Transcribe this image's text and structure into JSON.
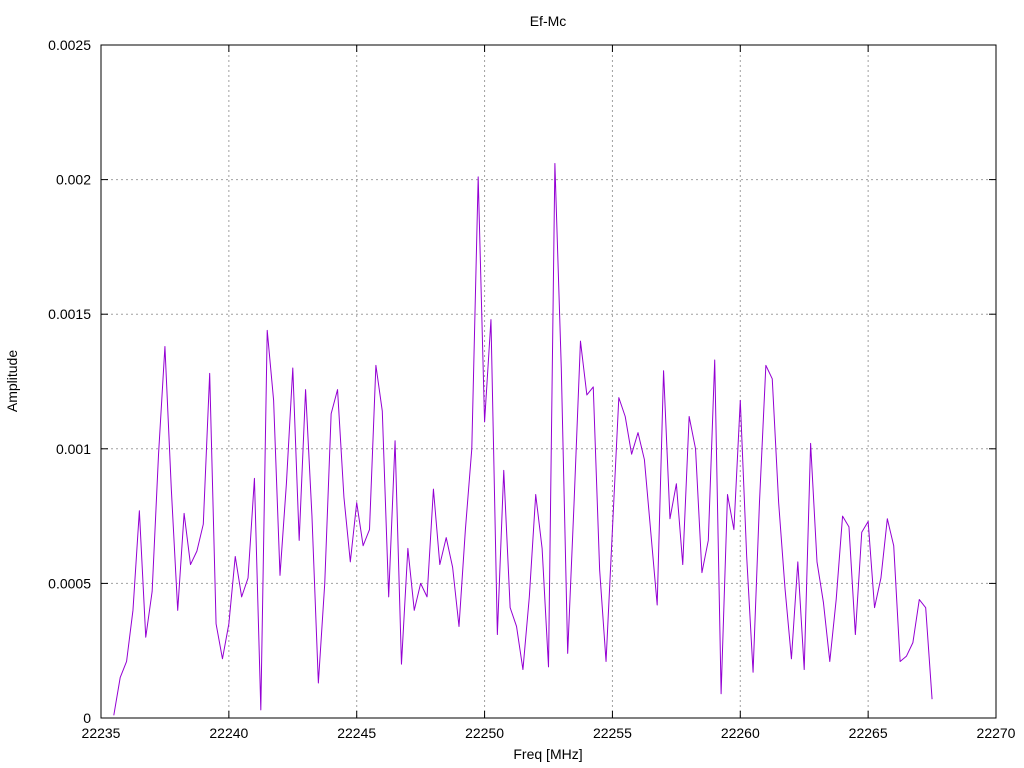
{
  "chart_data": {
    "type": "line",
    "title": "Ef-Mc",
    "xlabel": "Freq [MHz]",
    "ylabel": "Amplitude",
    "xlim": [
      22235,
      22270
    ],
    "ylim": [
      0,
      0.0025
    ],
    "x_ticks": [
      "22235",
      "22240",
      "22245",
      "22250",
      "22255",
      "22260",
      "22265",
      "22270"
    ],
    "x_tick_values": [
      22235,
      22240,
      22245,
      22250,
      22255,
      22260,
      22265,
      22270
    ],
    "y_ticks": [
      "0",
      "0.0005",
      "0.001",
      "0.0015",
      "0.002",
      "0.0025"
    ],
    "y_tick_values": [
      0,
      0.0005,
      0.001,
      0.0015,
      0.002,
      0.0025
    ],
    "grid": true,
    "legend": "none",
    "series": [
      {
        "color": "#9400d3",
        "x": [
          22235.5,
          22235.75,
          22236.0,
          22236.25,
          22236.5,
          22236.75,
          22237.0,
          22237.25,
          22237.5,
          22237.75,
          22238.0,
          22238.25,
          22238.5,
          22238.75,
          22239.0,
          22239.25,
          22239.5,
          22239.75,
          22240.0,
          22240.25,
          22240.5,
          22240.75,
          22241.0,
          22241.25,
          22241.5,
          22241.75,
          22242.0,
          22242.25,
          22242.5,
          22242.75,
          22243.0,
          22243.25,
          22243.5,
          22243.75,
          22244.0,
          22244.25,
          22244.5,
          22244.75,
          22245.0,
          22245.25,
          22245.5,
          22245.75,
          22246.0,
          22246.25,
          22246.5,
          22246.75,
          22247.0,
          22247.25,
          22247.5,
          22247.75,
          22248.0,
          22248.25,
          22248.5,
          22248.75,
          22249.0,
          22249.25,
          22249.5,
          22249.75,
          22250.0,
          22250.25,
          22250.5,
          22250.75,
          22251.0,
          22251.25,
          22251.5,
          22251.75,
          22252.0,
          22252.25,
          22252.5,
          22252.75,
          22253.0,
          22253.25,
          22253.5,
          22253.75,
          22254.0,
          22254.25,
          22254.5,
          22254.75,
          22255.0,
          22255.25,
          22255.5,
          22255.75,
          22256.0,
          22256.25,
          22256.5,
          22256.75,
          22257.0,
          22257.25,
          22257.5,
          22257.75,
          22258.0,
          22258.25,
          22258.5,
          22258.75,
          22259.0,
          22259.25,
          22259.5,
          22259.75,
          22260.0,
          22260.25,
          22260.5,
          22260.75,
          22261.0,
          22261.25,
          22261.5,
          22261.75,
          22262.0,
          22262.25,
          22262.5,
          22262.75,
          22263.0,
          22263.25,
          22263.5,
          22263.75,
          22264.0,
          22264.25,
          22264.5,
          22264.75,
          22265.0,
          22265.25,
          22265.5,
          22265.75,
          22266.0,
          22266.25,
          22266.5,
          22266.75,
          22267.0,
          22267.25,
          22267.5
        ],
        "y": [
          1e-05,
          0.00015,
          0.00021,
          0.0004,
          0.00077,
          0.0003,
          0.00047,
          0.00098,
          0.00138,
          0.00085,
          0.0004,
          0.00076,
          0.00057,
          0.00062,
          0.00072,
          0.00128,
          0.00035,
          0.00022,
          0.00035,
          0.0006,
          0.00045,
          0.00052,
          0.00089,
          3e-05,
          0.00144,
          0.00118,
          0.00053,
          0.00087,
          0.0013,
          0.00066,
          0.00122,
          0.00075,
          0.00013,
          0.0005,
          0.00113,
          0.00122,
          0.00082,
          0.00058,
          0.0008,
          0.00064,
          0.0007,
          0.00131,
          0.00114,
          0.00045,
          0.00103,
          0.0002,
          0.00063,
          0.0004,
          0.0005,
          0.00045,
          0.00085,
          0.00057,
          0.00067,
          0.00056,
          0.00034,
          0.0007,
          0.001,
          0.00201,
          0.0011,
          0.00148,
          0.00031,
          0.00092,
          0.00041,
          0.00034,
          0.00018,
          0.00045,
          0.00083,
          0.00063,
          0.00019,
          0.00206,
          0.0013,
          0.00024,
          0.0008,
          0.0014,
          0.0012,
          0.00123,
          0.00055,
          0.00021,
          0.0007,
          0.00119,
          0.00112,
          0.00098,
          0.00106,
          0.00096,
          0.00069,
          0.00042,
          0.00129,
          0.00074,
          0.00087,
          0.00057,
          0.00112,
          0.001,
          0.00054,
          0.00066,
          0.00133,
          9e-05,
          0.00083,
          0.0007,
          0.00118,
          0.0006,
          0.00017,
          0.0008,
          0.00131,
          0.00126,
          0.0008,
          0.00048,
          0.00022,
          0.00058,
          0.00018,
          0.00102,
          0.00058,
          0.00043,
          0.00021,
          0.00044,
          0.00075,
          0.00071,
          0.00031,
          0.00069,
          0.00073,
          0.00041,
          0.00052,
          0.00074,
          0.00064,
          0.00021,
          0.00023,
          0.00028,
          0.00044,
          0.00041,
          7e-05
        ]
      }
    ]
  }
}
